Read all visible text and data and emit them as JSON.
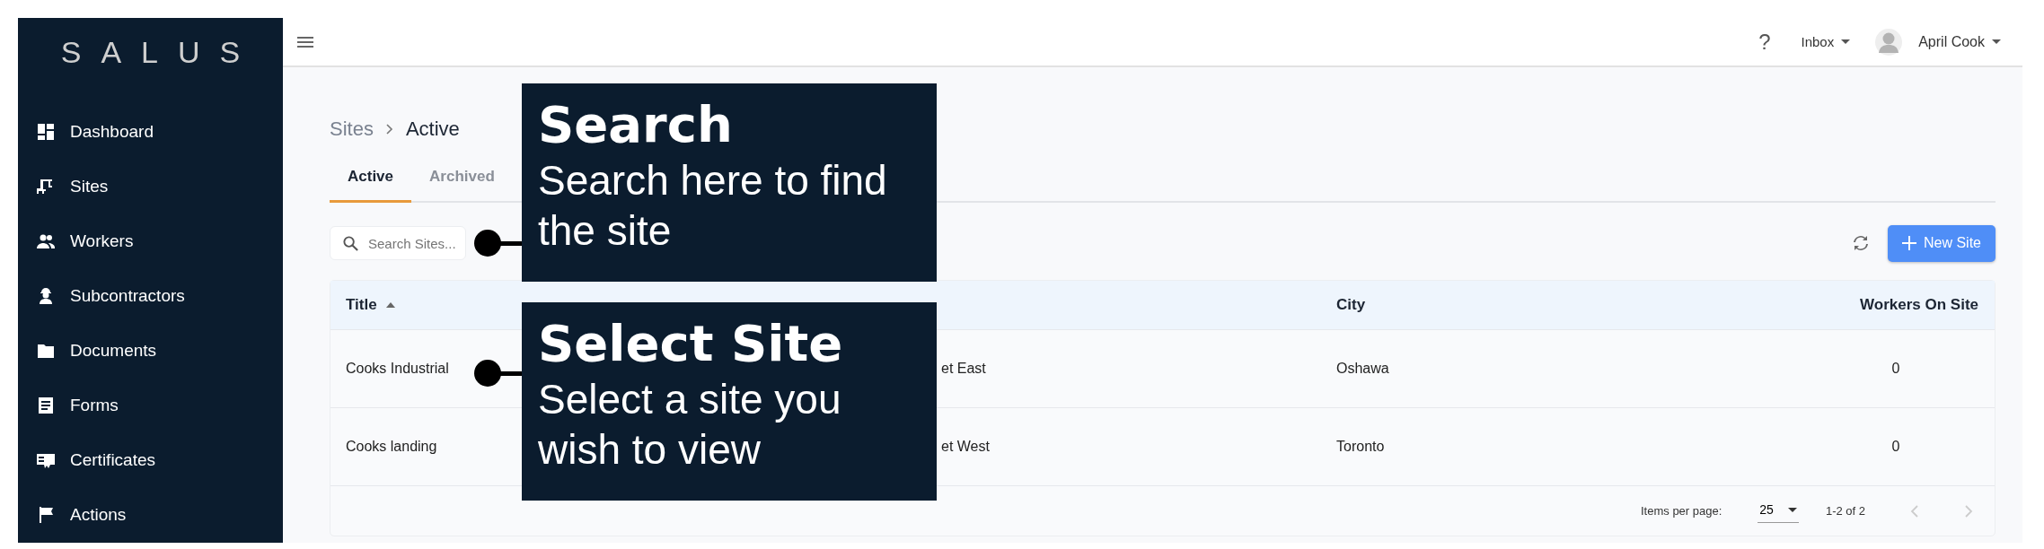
{
  "sidebar": {
    "logo": "SALUS",
    "items": [
      {
        "label": "Dashboard"
      },
      {
        "label": "Sites"
      },
      {
        "label": "Workers"
      },
      {
        "label": "Subcontractors"
      },
      {
        "label": "Documents"
      },
      {
        "label": "Forms"
      },
      {
        "label": "Certificates"
      },
      {
        "label": "Actions"
      }
    ]
  },
  "top_bar": {
    "help": "?",
    "inbox": "Inbox",
    "user": "April Cook"
  },
  "breadcrumb": [
    "Sites",
    "Active"
  ],
  "tabs": [
    {
      "label": "Active",
      "selected": true
    },
    {
      "label": "Archived",
      "selected": false
    }
  ],
  "search": {
    "placeholder": "Search Sites..."
  },
  "new_button": "New Site",
  "table": {
    "columns": [
      {
        "label": "Title",
        "sorted": true
      },
      {
        "label": "City",
        "sorted": false
      },
      {
        "label": "Workers On Site",
        "sorted": false
      }
    ],
    "rows": [
      {
        "title": "Cooks Industrial",
        "column_2": "et East",
        "city": "Oshawa",
        "workers": "0"
      },
      {
        "title": "Cooks landing",
        "column_2": "et West",
        "city": "Toronto",
        "workers": "0"
      }
    ]
  },
  "pagination": {
    "label": "Items per page:",
    "page_size": "25",
    "range": "1-2 of 2",
    "prev_disabled": true,
    "next_disabled": true
  },
  "callouts": [
    {
      "title": "Search",
      "text": "Search here to find the site"
    },
    {
      "title": "Select Site",
      "text": "Select a site you wish to view"
    }
  ]
}
